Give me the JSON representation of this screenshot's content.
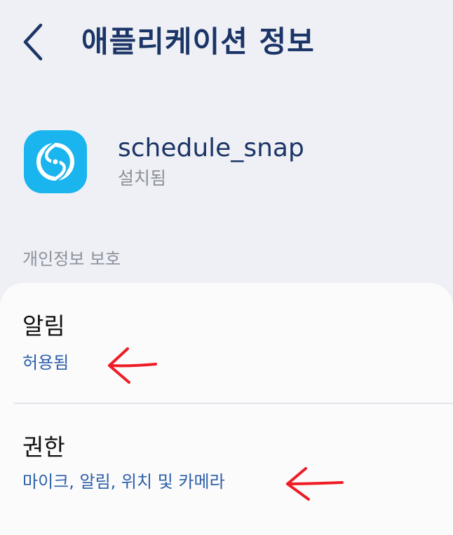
{
  "header": {
    "back_icon": "chevron-left-icon",
    "title": "애플리케이션 정보"
  },
  "app": {
    "icon": "app-logo-icon",
    "icon_color": "#1ab4ee",
    "name": "schedule_snap",
    "status": "설치됨"
  },
  "privacy_section": {
    "label": "개인정보 보호",
    "rows": [
      {
        "title": "알림",
        "subtitle": "허용됨",
        "annotation": "red-arrow-icon"
      },
      {
        "title": "권한",
        "subtitle": "마이크, 알림, 위치 및 카메라",
        "annotation": "red-arrow-icon"
      }
    ]
  },
  "colors": {
    "background": "#eef0f5",
    "card": "#fbfbfc",
    "title_text": "#1c3567",
    "subtitle_text": "#2c5fa8",
    "annotation_arrow": "#ee1c25"
  }
}
